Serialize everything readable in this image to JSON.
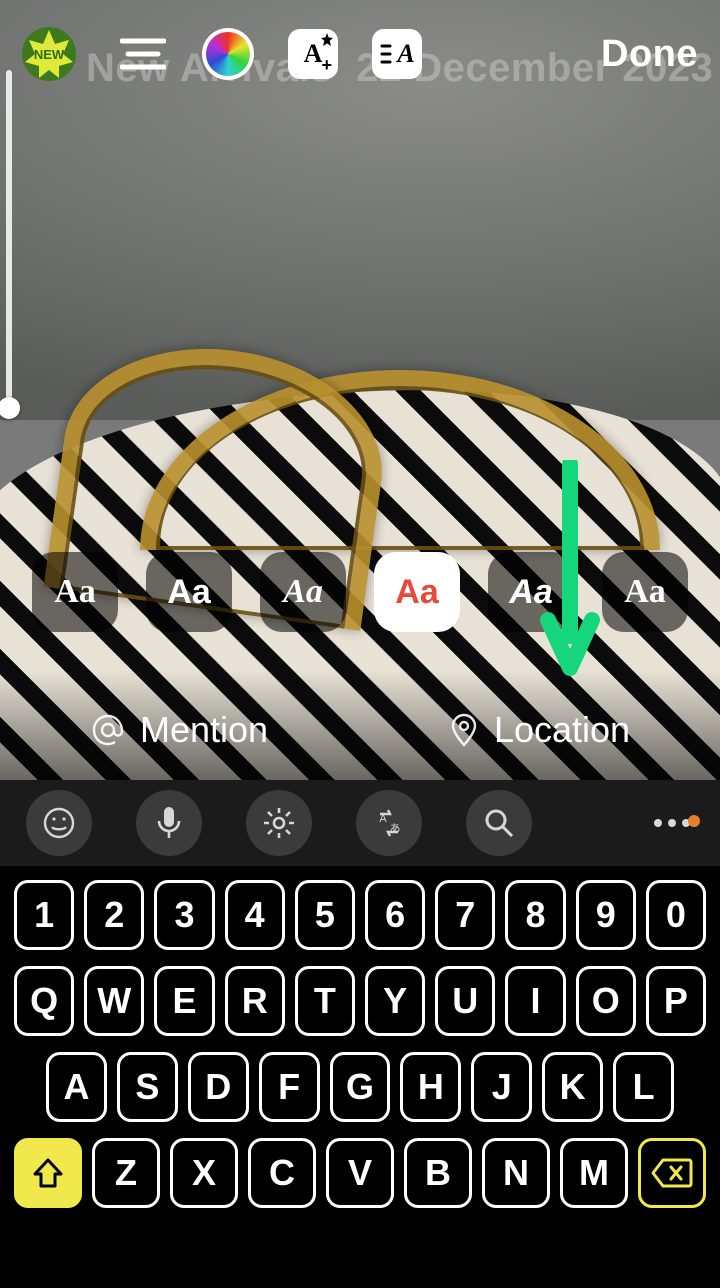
{
  "story_text": "New Arrivals  22 December 2023",
  "new_badge_label": "NEW",
  "topbar": {
    "done_label": "Done",
    "style_button": "A",
    "effect_button": "A"
  },
  "font_row": {
    "styles": [
      "Aa",
      "Aa",
      "Aa",
      "Aa",
      "Aa",
      "Aa"
    ],
    "selected_index": 3
  },
  "suggestions": {
    "mention_label": "Mention",
    "location_label": "Location"
  },
  "annotation_arrow": {
    "color": "#15d67a"
  },
  "keyboard": {
    "row1": [
      "1",
      "2",
      "3",
      "4",
      "5",
      "6",
      "7",
      "8",
      "9",
      "0"
    ],
    "row2": [
      "Q",
      "W",
      "E",
      "R",
      "T",
      "Y",
      "U",
      "I",
      "O",
      "P"
    ],
    "row3": [
      "A",
      "S",
      "D",
      "F",
      "G",
      "H",
      "J",
      "K",
      "L"
    ],
    "row4": [
      "Z",
      "X",
      "C",
      "V",
      "B",
      "N",
      "M"
    ]
  }
}
